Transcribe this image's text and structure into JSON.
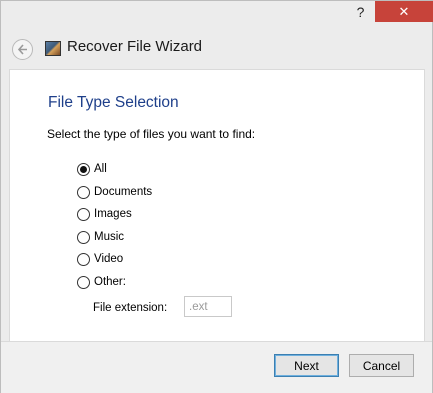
{
  "titlebar": {
    "help_glyph": "?",
    "close_glyph": "✕"
  },
  "header": {
    "title": "Recover File Wizard",
    "back_icon": "back-arrow-icon",
    "app_icon": "app-icon"
  },
  "content": {
    "section_title": "File Type Selection",
    "prompt": "Select the type of files you want to find:",
    "file_types": [
      {
        "label": "All",
        "checked": true
      },
      {
        "label": "Documents",
        "checked": false
      },
      {
        "label": "Images",
        "checked": false
      },
      {
        "label": "Music",
        "checked": false
      },
      {
        "label": "Video",
        "checked": false
      },
      {
        "label": "Other:",
        "checked": false
      }
    ],
    "extension": {
      "label": "File extension:",
      "placeholder": ".ext",
      "value": ""
    }
  },
  "footer": {
    "next_label": "Next",
    "cancel_label": "Cancel"
  },
  "colors": {
    "section_title": "#1e3f8a",
    "close_button": "#c7433a"
  }
}
